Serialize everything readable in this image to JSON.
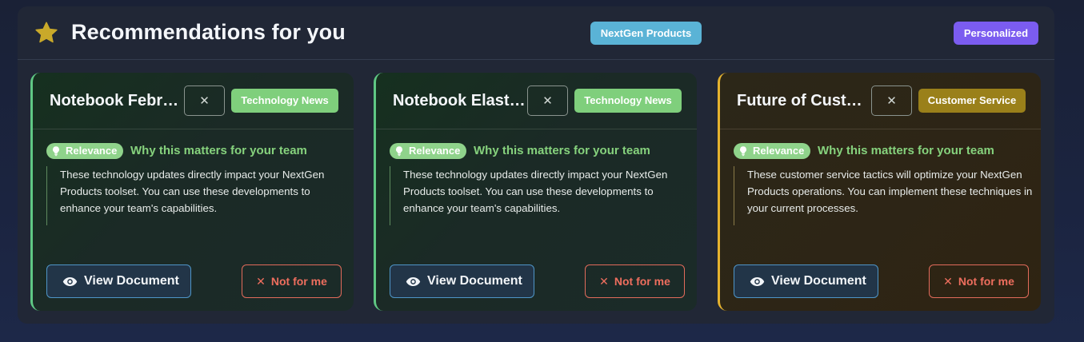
{
  "panel": {
    "title": "Recommendations for you",
    "badges": {
      "nextgen": "NextGen Products",
      "personalized": "Personalized"
    },
    "accent_colors": {
      "nextgen": "#5ab3d6",
      "personalized": "#7b5cf0",
      "star": "#c9a92a"
    }
  },
  "cards": [
    {
      "title": "Notebook February…",
      "category": "Technology News",
      "close_label": "✕",
      "relevance_label": "Relevance",
      "why_heading": "Why this matters for your team",
      "reason": "These technology updates directly impact your NextGen Products toolset. You can use these developments to enhance your team's capabilities.",
      "view_label": "View Document",
      "not_for_me_label": "Not for me",
      "accent": "#5fc884"
    },
    {
      "title": "Notebook Elastic…",
      "category": "Technology News",
      "close_label": "✕",
      "relevance_label": "Relevance",
      "why_heading": "Why this matters for your team",
      "reason": "These technology updates directly impact your NextGen Products toolset. You can use these developments to enhance your team's capabilities.",
      "view_label": "View Document",
      "not_for_me_label": "Not for me",
      "accent": "#5fc884"
    },
    {
      "title": "Future of Customer…",
      "category": "Customer Service",
      "close_label": "✕",
      "relevance_label": "Relevance",
      "why_heading": "Why this matters for your team",
      "reason": "These customer service tactics will optimize your NextGen Products operations. You can implement these techniques in your current processes.",
      "view_label": "View Document",
      "not_for_me_label": "Not for me",
      "accent": "#e5b22e"
    }
  ]
}
